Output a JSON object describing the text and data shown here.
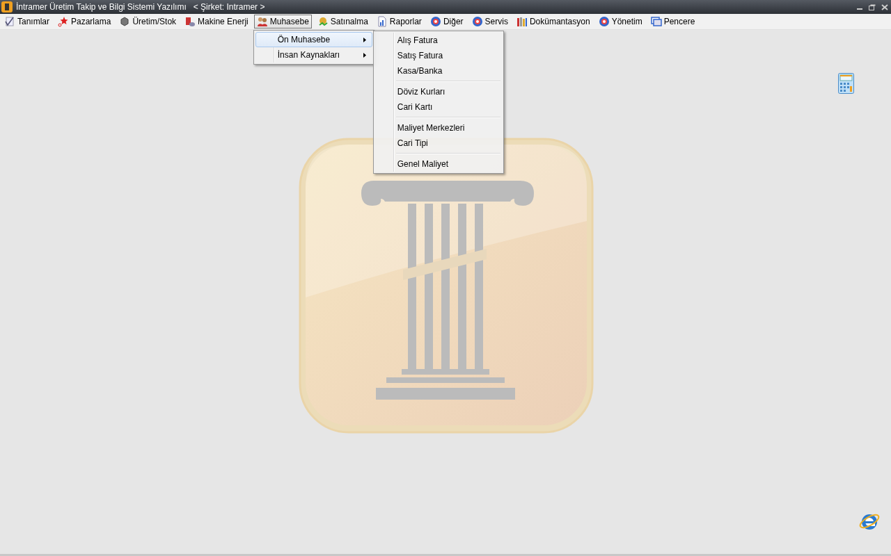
{
  "window": {
    "title": "İntramer Üretim Takip ve Bilgi Sistemi Yazılımı",
    "company": "< Şirket: Intramer >"
  },
  "menubar": [
    {
      "label": "Tanımlar",
      "selected": false
    },
    {
      "label": "Pazarlama",
      "selected": false
    },
    {
      "label": "Üretim/Stok",
      "selected": false
    },
    {
      "label": "Makine Enerji",
      "selected": false
    },
    {
      "label": "Muhasebe",
      "selected": true
    },
    {
      "label": "Satınalma",
      "selected": false
    },
    {
      "label": "Raporlar",
      "selected": false
    },
    {
      "label": "Diğer",
      "selected": false
    },
    {
      "label": "Servis",
      "selected": false
    },
    {
      "label": "Dokümantasyon",
      "selected": false
    },
    {
      "label": "Yönetim",
      "selected": false
    },
    {
      "label": "Pencere",
      "selected": false
    }
  ],
  "dropdown": [
    {
      "label": "Ön Muhasebe",
      "selected": true
    },
    {
      "label": "İnsan Kaynakları",
      "selected": false
    }
  ],
  "submenu": [
    [
      "Alış Fatura",
      "Satış Fatura",
      "Kasa/Banka"
    ],
    [
      "Döviz Kurları",
      "Cari Kartı"
    ],
    [
      "Maliyet Merkezleri",
      "Cari Tipi"
    ],
    [
      "Genel Maliyet"
    ]
  ]
}
